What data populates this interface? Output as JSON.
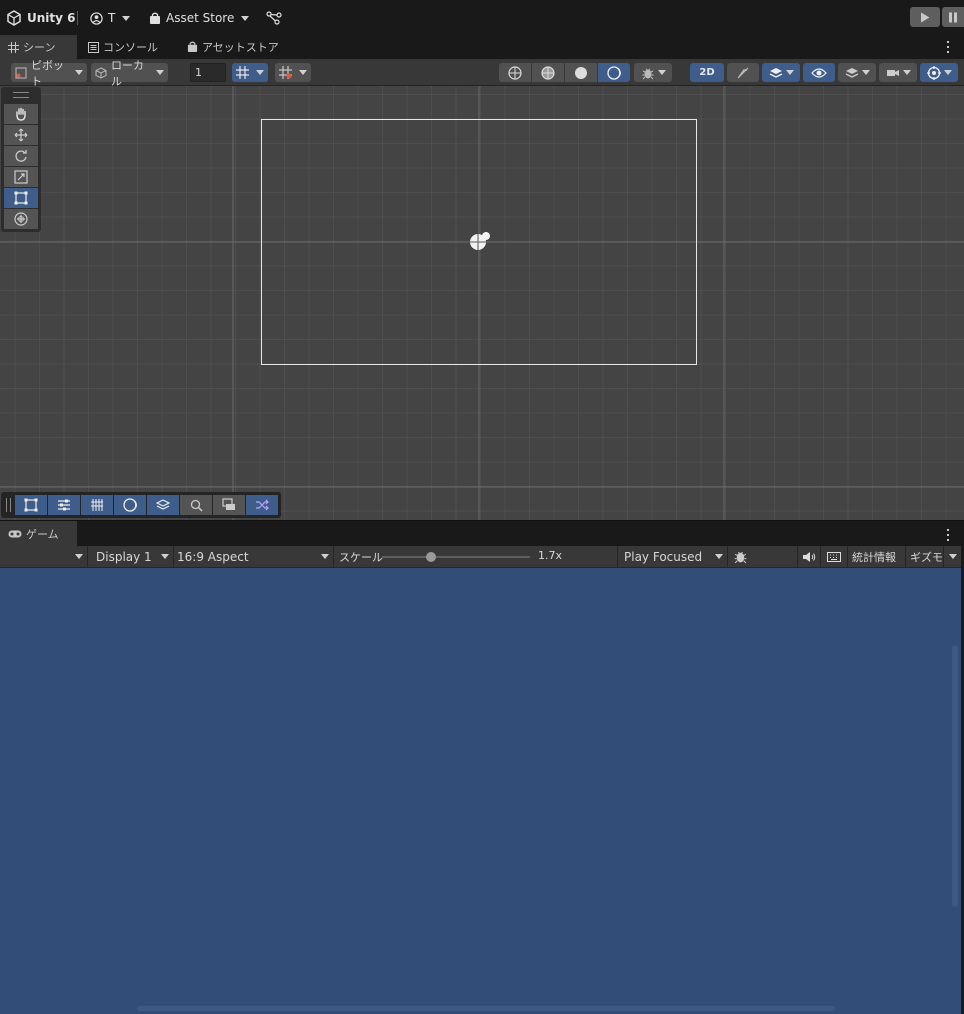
{
  "topbar": {
    "app_name": "Unity 6",
    "account": "T",
    "asset_store": "Asset Store"
  },
  "tabs": [
    {
      "label": "シーン",
      "active": true
    },
    {
      "label": "コンソール",
      "active": false
    },
    {
      "label": "アセットストア",
      "active": false
    }
  ],
  "scene_toolbar": {
    "pivot_label": "ピボット",
    "local_label": "ローカル",
    "grid_value": "1",
    "mode_2d": "2D"
  },
  "game": {
    "tab_label": "ゲーム",
    "display": "Display 1",
    "aspect": "16:9 Aspect",
    "scale_label": "スケール",
    "scale_value": "1.7x",
    "scale_fraction": 0.33,
    "play_mode": "Play Focused",
    "stats_label": "統計情報",
    "gizmos_label": "ギズモ"
  },
  "colors": {
    "accent": "#3e5d8a",
    "game_bg": "#314d78",
    "scene_bg": "#444444"
  },
  "icons": [
    "unity-logo-icon",
    "account-icon",
    "asset-store-icon",
    "version-control-icon",
    "play-icon",
    "pause-icon",
    "hand-icon",
    "move-icon",
    "rotate-icon",
    "scale-icon",
    "rect-icon",
    "transform-icon",
    "camera-gizmo-icon",
    "gamepad-icon",
    "audio-icon",
    "keyboard-icon",
    "debug-icon"
  ]
}
